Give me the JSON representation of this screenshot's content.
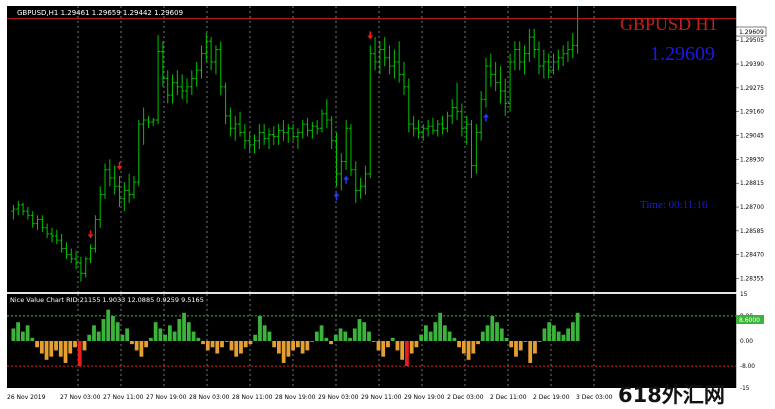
{
  "main_panel": {
    "info": "GBPUSD,H1  1.29461 1.29659 1.29442 1.29609",
    "symbol_label": "GBPUSD H1",
    "price_label": "1.29609",
    "timer_label": "Time: 00:11:16",
    "current_price_tag": "1.29609",
    "y_ticks": [
      "1.29505",
      "1.29390",
      "1.29275",
      "1.29160",
      "1.29045",
      "1.28930",
      "1.28815",
      "1.28700",
      "1.28585",
      "1.28470",
      "1.28355"
    ]
  },
  "sub_panel": {
    "info": "Nice Value Chart RID:21155 1.9033 12.0885 0.9259 9.5165",
    "y_ticks": [
      "15",
      "8.00",
      "0.00",
      "-8.00",
      "-15"
    ],
    "current_value_tag": "8.6000"
  },
  "x_axis": {
    "labels": [
      "26 Nov 2019",
      "27 Nov 03:00",
      "27 Nov 11:00",
      "27 Nov 19:00",
      "28 Nov 03:00",
      "28 Nov 11:00",
      "28 Nov 19:00",
      "29 Nov 03:00",
      "29 Nov 11:00",
      "29 Nov 19:00",
      "2 Dec 03:00",
      "2 Dec 11:00",
      "2 Dec 19:00",
      "3 Dec 03:00"
    ]
  },
  "watermark": "618外汇网",
  "colors": {
    "background": "#000000",
    "bar": "#00c400",
    "grid": "#c8c8c8",
    "current_price_line": "#c81e1e",
    "symbol_label": "#c81e1e",
    "price_label": "#1a1ae6",
    "timer_label": "#1a1ae6",
    "arrow_up": "#1e3cff",
    "arrow_down": "#e61e1e",
    "value_green": "#3cb43c",
    "value_orange": "#e6a032",
    "value_red": "#e61e1e"
  },
  "chart_data": [
    {
      "type": "ohlc",
      "title": "GBPUSD,H1",
      "ylim": [
        1.2829,
        1.2967
      ],
      "last_price": 1.29609,
      "bars": [
        [
          1.2868,
          1.2871,
          1.2864,
          1.2869
        ],
        [
          1.2869,
          1.2873,
          1.2866,
          1.2871
        ],
        [
          1.2871,
          1.2872,
          1.2866,
          1.2868
        ],
        [
          1.2868,
          1.287,
          1.2864,
          1.2866
        ],
        [
          1.2866,
          1.2868,
          1.286,
          1.2862
        ],
        [
          1.2862,
          1.2866,
          1.2859,
          1.2864
        ],
        [
          1.2864,
          1.2866,
          1.2858,
          1.286
        ],
        [
          1.286,
          1.2862,
          1.2855,
          1.2857
        ],
        [
          1.2857,
          1.286,
          1.2853,
          1.2856
        ],
        [
          1.2856,
          1.2859,
          1.2852,
          1.2854
        ],
        [
          1.2854,
          1.2857,
          1.2848,
          1.285
        ],
        [
          1.285,
          1.2853,
          1.2845,
          1.2847
        ],
        [
          1.2847,
          1.285,
          1.2843,
          1.2845
        ],
        [
          1.2845,
          1.2849,
          1.284,
          1.2843
        ],
        [
          1.2843,
          1.2846,
          1.2834,
          1.2838
        ],
        [
          1.2838,
          1.2846,
          1.2836,
          1.2845
        ],
        [
          1.2845,
          1.2852,
          1.2843,
          1.285
        ],
        [
          1.285,
          1.2866,
          1.2848,
          1.2864
        ],
        [
          1.2864,
          1.288,
          1.286,
          1.2876
        ],
        [
          1.2876,
          1.2891,
          1.2874,
          1.2888
        ],
        [
          1.2888,
          1.2893,
          1.288,
          1.2884
        ],
        [
          1.2884,
          1.289,
          1.2876,
          1.288
        ],
        [
          1.288,
          1.2885,
          1.287,
          1.2874
        ],
        [
          1.2874,
          1.2882,
          1.2868,
          1.2878
        ],
        [
          1.2878,
          1.2886,
          1.2872,
          1.2876
        ],
        [
          1.2876,
          1.2885,
          1.2874,
          1.2882
        ],
        [
          1.2882,
          1.2912,
          1.288,
          1.291
        ],
        [
          1.291,
          1.2918,
          1.29,
          1.2912
        ],
        [
          1.2912,
          1.2914,
          1.2908,
          1.2911
        ],
        [
          1.2911,
          1.2913,
          1.2909,
          1.2912
        ],
        [
          1.2912,
          1.2953,
          1.291,
          1.2945
        ],
        [
          1.2945,
          1.295,
          1.2928,
          1.2932
        ],
        [
          1.2932,
          1.2936,
          1.292,
          1.2924
        ],
        [
          1.2924,
          1.2934,
          1.292,
          1.293
        ],
        [
          1.293,
          1.2936,
          1.2924,
          1.2928
        ],
        [
          1.2928,
          1.2934,
          1.2922,
          1.2926
        ],
        [
          1.2926,
          1.2932,
          1.292,
          1.2928
        ],
        [
          1.2928,
          1.2936,
          1.2924,
          1.2932
        ],
        [
          1.2932,
          1.294,
          1.2928,
          1.2936
        ],
        [
          1.2936,
          1.2948,
          1.2932,
          1.2944
        ],
        [
          1.2944,
          1.2954,
          1.294,
          1.295
        ],
        [
          1.295,
          1.2952,
          1.2936,
          1.294
        ],
        [
          1.294,
          1.2948,
          1.2934,
          1.2946
        ],
        [
          1.2946,
          1.295,
          1.2924,
          1.2928
        ],
        [
          1.2928,
          1.293,
          1.291,
          1.2914
        ],
        [
          1.2914,
          1.2918,
          1.2904,
          1.2908
        ],
        [
          1.2908,
          1.2914,
          1.2902,
          1.291
        ],
        [
          1.291,
          1.2916,
          1.2904,
          1.2906
        ],
        [
          1.2906,
          1.291,
          1.2898,
          1.2902
        ],
        [
          1.2902,
          1.2906,
          1.2896,
          1.29
        ],
        [
          1.29,
          1.2905,
          1.2896,
          1.2902
        ],
        [
          1.2902,
          1.291,
          1.2898,
          1.2906
        ],
        [
          1.2906,
          1.291,
          1.29,
          1.2903
        ],
        [
          1.2903,
          1.2908,
          1.2898,
          1.2905
        ],
        [
          1.2905,
          1.2909,
          1.29,
          1.2904
        ],
        [
          1.2904,
          1.291,
          1.29,
          1.2907
        ],
        [
          1.2907,
          1.2912,
          1.2902,
          1.2906
        ],
        [
          1.2906,
          1.291,
          1.2901,
          1.2908
        ],
        [
          1.2908,
          1.291,
          1.2902,
          1.2904
        ],
        [
          1.2904,
          1.2908,
          1.2898,
          1.2906
        ],
        [
          1.2906,
          1.2912,
          1.2903,
          1.291
        ],
        [
          1.291,
          1.2913,
          1.2904,
          1.2907
        ],
        [
          1.2907,
          1.2911,
          1.2903,
          1.2909
        ],
        [
          1.2909,
          1.2912,
          1.2905,
          1.2908
        ],
        [
          1.2908,
          1.2917,
          1.2906,
          1.2915
        ],
        [
          1.2915,
          1.2922,
          1.2908,
          1.2912
        ],
        [
          1.2912,
          1.2914,
          1.2898,
          1.2902
        ],
        [
          1.2902,
          1.2906,
          1.288,
          1.2886
        ],
        [
          1.2886,
          1.2896,
          1.2878,
          1.2892
        ],
        [
          1.2892,
          1.2912,
          1.2888,
          1.2908
        ],
        [
          1.2908,
          1.291,
          1.2885,
          1.2888
        ],
        [
          1.2888,
          1.2892,
          1.2872,
          1.2878
        ],
        [
          1.2878,
          1.2884,
          1.2874,
          1.288
        ],
        [
          1.288,
          1.289,
          1.2876,
          1.2886
        ],
        [
          1.2886,
          1.2948,
          1.2884,
          1.2944
        ],
        [
          1.2944,
          1.2952,
          1.2936,
          1.294
        ],
        [
          1.294,
          1.295,
          1.2934,
          1.2946
        ],
        [
          1.2946,
          1.2952,
          1.2938,
          1.2942
        ],
        [
          1.2942,
          1.2948,
          1.2934,
          1.2938
        ],
        [
          1.2938,
          1.2946,
          1.2932,
          1.294
        ],
        [
          1.294,
          1.295,
          1.293,
          1.2934
        ],
        [
          1.2934,
          1.294,
          1.2924,
          1.2928
        ],
        [
          1.2928,
          1.2932,
          1.2906,
          1.291
        ],
        [
          1.291,
          1.2914,
          1.2904,
          1.2908
        ],
        [
          1.2908,
          1.2912,
          1.2903,
          1.2906
        ],
        [
          1.2906,
          1.291,
          1.2902,
          1.2908
        ],
        [
          1.2908,
          1.2912,
          1.2904,
          1.2909
        ],
        [
          1.2909,
          1.2913,
          1.2905,
          1.2907
        ],
        [
          1.2907,
          1.2912,
          1.2904,
          1.291
        ],
        [
          1.291,
          1.2914,
          1.2905,
          1.2908
        ],
        [
          1.2908,
          1.2916,
          1.2906,
          1.2914
        ],
        [
          1.2914,
          1.2922,
          1.291,
          1.2918
        ],
        [
          1.2918,
          1.293,
          1.2912,
          1.2916
        ],
        [
          1.2916,
          1.292,
          1.2904,
          1.2908
        ],
        [
          1.2908,
          1.2914,
          1.29,
          1.291
        ],
        [
          1.291,
          1.2912,
          1.2884,
          1.289
        ],
        [
          1.289,
          1.291,
          1.2886,
          1.2906
        ],
        [
          1.2906,
          1.2926,
          1.2902,
          1.2922
        ],
        [
          1.2922,
          1.2942,
          1.2918,
          1.2938
        ],
        [
          1.2938,
          1.2944,
          1.2928,
          1.2934
        ],
        [
          1.2934,
          1.294,
          1.2926,
          1.293
        ],
        [
          1.293,
          1.2938,
          1.292,
          1.2926
        ],
        [
          1.2926,
          1.2932,
          1.2914,
          1.292
        ],
        [
          1.292,
          1.2944,
          1.2916,
          1.294
        ],
        [
          1.294,
          1.295,
          1.2936,
          1.2946
        ],
        [
          1.2946,
          1.295,
          1.2936,
          1.294
        ],
        [
          1.294,
          1.2948,
          1.2934,
          1.2944
        ],
        [
          1.2944,
          1.2956,
          1.294,
          1.2952
        ],
        [
          1.2952,
          1.2956,
          1.2942,
          1.2946
        ],
        [
          1.2946,
          1.295,
          1.2934,
          1.2938
        ],
        [
          1.2938,
          1.2946,
          1.2932,
          1.294
        ],
        [
          1.294,
          1.2944,
          1.2932,
          1.2936
        ],
        [
          1.2936,
          1.2944,
          1.2934,
          1.294
        ],
        [
          1.294,
          1.2946,
          1.2936,
          1.2942
        ],
        [
          1.2942,
          1.2948,
          1.2938,
          1.2944
        ],
        [
          1.2944,
          1.295,
          1.294,
          1.2946
        ],
        [
          1.2946,
          1.2954,
          1.2942,
          1.2948
        ],
        [
          1.2948,
          1.2967,
          1.2944,
          1.2961
        ]
      ],
      "arrows": [
        {
          "bar": 16,
          "dir": "down"
        },
        {
          "bar": 22,
          "dir": "down"
        },
        {
          "bar": 67,
          "dir": "up"
        },
        {
          "bar": 69,
          "dir": "up"
        },
        {
          "bar": 74,
          "dir": "down"
        },
        {
          "bar": 98,
          "dir": "up"
        }
      ]
    },
    {
      "type": "bar",
      "title": "Nice Value Chart",
      "ylim": [
        -15,
        15
      ],
      "levels": [
        8,
        -8
      ],
      "values": [
        4,
        6,
        3,
        5,
        1,
        -2,
        -4,
        -6,
        -5,
        -3,
        -5,
        -7,
        -4,
        -2,
        -8,
        -3,
        2,
        5,
        3,
        7,
        10,
        8,
        6,
        2,
        4,
        -1,
        -3,
        -5,
        -2,
        1,
        6,
        4,
        2,
        5,
        3,
        7,
        9,
        6,
        3,
        1,
        -1,
        -3,
        -2,
        -4,
        -2,
        0,
        -3,
        -5,
        -4,
        -2,
        -1,
        2,
        8,
        5,
        3,
        -2,
        -4,
        -7,
        -5,
        -3,
        -2,
        -4,
        -3,
        0,
        3,
        5,
        1,
        -1,
        2,
        4,
        3,
        1,
        4,
        7,
        6,
        3,
        0,
        -3,
        -5,
        -2,
        1,
        -3,
        -6,
        -8,
        -4,
        -2,
        2,
        5,
        3,
        6,
        9,
        5,
        3,
        1,
        -2,
        -4,
        -6,
        -4,
        -1,
        3,
        5,
        8,
        6,
        4,
        1,
        -2,
        -5,
        -3,
        0,
        -7,
        -4,
        0,
        4,
        6,
        5,
        3,
        2,
        4,
        6,
        9
      ]
    }
  ]
}
